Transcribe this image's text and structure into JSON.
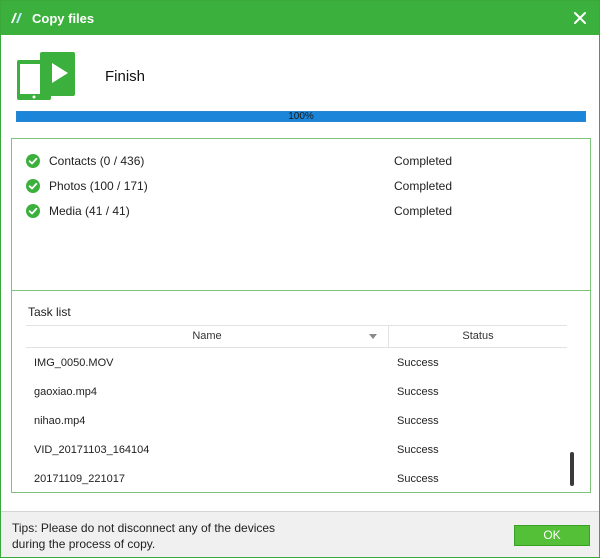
{
  "window": {
    "title": "Copy files",
    "status_heading": "Finish"
  },
  "progress": {
    "value": 100,
    "label": "100%"
  },
  "summary": [
    {
      "label": "Contacts (0 / 436)",
      "status": "Completed"
    },
    {
      "label": "Photos (100 / 171)",
      "status": "Completed"
    },
    {
      "label": "Media (41 / 41)",
      "status": "Completed"
    }
  ],
  "task_list": {
    "title": "Task list",
    "columns": {
      "name": "Name",
      "status": "Status"
    },
    "rows": [
      {
        "name": "IMG_0050.MOV",
        "status": "Success"
      },
      {
        "name": "gaoxiao.mp4",
        "status": "Success"
      },
      {
        "name": "nihao.mp4",
        "status": "Success"
      },
      {
        "name": "VID_20171103_164104",
        "status": "Success"
      },
      {
        "name": "20171109_221017",
        "status": "Success"
      }
    ]
  },
  "footer": {
    "tips_line1": "Tips: Please do not disconnect any of the devices",
    "tips_line2": "during the process of copy.",
    "ok_label": "OK"
  },
  "colors": {
    "title_bar": "#3cb03c",
    "progress_fill": "#1b86d9",
    "check": "#3cb03c",
    "ok_button": "#54c038"
  },
  "icons": {
    "app": "app-logo-icon",
    "close": "close-icon",
    "device": "device-transfer-icon",
    "check": "check-circle-icon",
    "sort": "chevron-down-icon"
  }
}
